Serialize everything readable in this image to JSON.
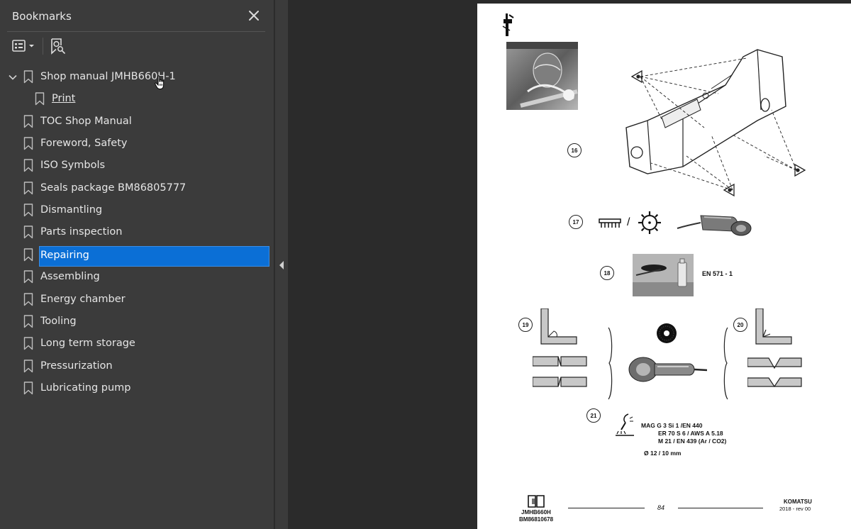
{
  "sidebar": {
    "title": "Bookmarks",
    "close_icon": "close-icon",
    "toolbar": {
      "options_icon": "bookmark-options-icon",
      "find_icon": "find-bookmark-icon"
    },
    "items": [
      {
        "label": "Shop manual JMHB660H-1",
        "expanded": true,
        "level": 0
      },
      {
        "label": "Print",
        "level": 1
      },
      {
        "label": "TOC Shop Manual",
        "level": 0
      },
      {
        "label": "Foreword, Safety",
        "level": 0
      },
      {
        "label": "ISO Symbols",
        "level": 0
      },
      {
        "label": "Seals package BM86805777",
        "level": 0
      },
      {
        "label": "Dismantling",
        "level": 0
      },
      {
        "label": "Parts inspection",
        "level": 0
      },
      {
        "label": "Repairing",
        "level": 0,
        "selected": true
      },
      {
        "label": "Assembling",
        "level": 0
      },
      {
        "label": "Energy chamber",
        "level": 0
      },
      {
        "label": "Tooling",
        "level": 0
      },
      {
        "label": "Long term storage",
        "level": 0
      },
      {
        "label": "Pressurization",
        "level": 0
      },
      {
        "label": "Lubricating pump",
        "level": 0
      }
    ]
  },
  "colors": {
    "selection": "#0b6fd6",
    "sidebar_bg": "#3b3b3b",
    "canvas_bg": "#2b2b2b",
    "text": "#e6e6e6"
  },
  "page": {
    "steps": [
      "16",
      "17",
      "18",
      "19",
      "20",
      "21"
    ],
    "step18_text": "EN 571 -  1",
    "slash": "/",
    "welding": {
      "line1": "MAG  G 3 Si 1 /EN 440",
      "line2": "ER 70 S 6 / AWS A 5.18",
      "line3": "M 21 / EN 439 (Ar / CO2)",
      "line4": "Ø 12 / 10 mm"
    },
    "footer": {
      "model": "JMHB660H",
      "code": "BM86810678",
      "page_number": "84",
      "brand": "KOMATSU",
      "revision": "2018 -  rev 00"
    }
  }
}
